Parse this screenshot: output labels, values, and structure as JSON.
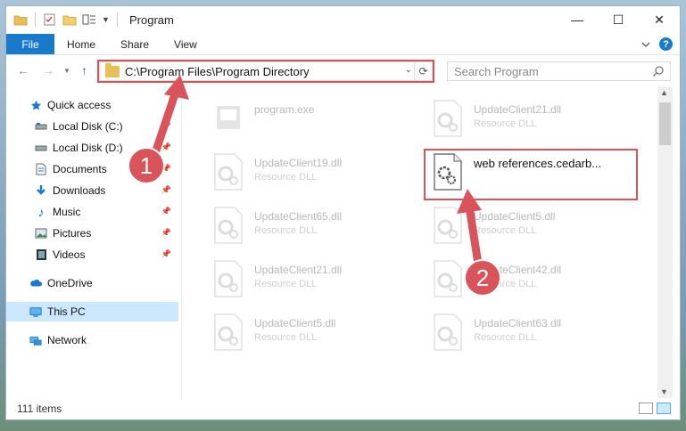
{
  "window": {
    "title": "Program",
    "controls": {
      "minimize": "—",
      "maximize": "☐",
      "close": "✕"
    }
  },
  "ribbon": {
    "tabs": [
      {
        "label": "File"
      },
      {
        "label": "Home"
      },
      {
        "label": "Share"
      },
      {
        "label": "View"
      }
    ],
    "expand_icon": "chevron-down-icon",
    "help_label": "?"
  },
  "nav": {
    "address": "C:\\Program Files\\Program Directory",
    "search_placeholder": "Search Program"
  },
  "sidebar": {
    "items": [
      {
        "label": "Quick access",
        "icon": "star-icon"
      },
      {
        "label": "Local Disk (C:)",
        "icon": "drive-icon",
        "pinned": true
      },
      {
        "label": "Local Disk (D:)",
        "icon": "drive-icon",
        "pinned": true
      },
      {
        "label": "Documents",
        "icon": "documents-icon",
        "pinned": true
      },
      {
        "label": "Downloads",
        "icon": "download-icon",
        "pinned": true
      },
      {
        "label": "Music",
        "icon": "music-icon",
        "pinned": true
      },
      {
        "label": "Pictures",
        "icon": "pictures-icon",
        "pinned": true
      },
      {
        "label": "Videos",
        "icon": "videos-icon",
        "pinned": true
      },
      {
        "label": "OneDrive",
        "icon": "cloud-icon"
      },
      {
        "label": "This PC",
        "icon": "computer-icon",
        "selected": true
      },
      {
        "label": "Network",
        "icon": "network-icon"
      }
    ]
  },
  "files": {
    "left": [
      {
        "name": "program.exe",
        "type": ""
      },
      {
        "name": "UpdateClient19.dll",
        "type": "Resource DLL"
      },
      {
        "name": "UpdateClient65.dll",
        "type": "Resource DLL"
      },
      {
        "name": "UpdateClient21.dll",
        "type": "Resource DLL"
      },
      {
        "name": "UpdateClient5.dll",
        "type": "Resource DLL"
      }
    ],
    "right": [
      {
        "name": "UpdateClient21.dll",
        "type": "Resource DLL"
      },
      {
        "name": "web references.cedarb...",
        "type": "",
        "highlighted": true
      },
      {
        "name": "UpdateClient5.dll",
        "type": "Resource DLL"
      },
      {
        "name": "UpdateClient42.dll",
        "type": "Resource DLL"
      },
      {
        "name": "UpdateClient63.dll",
        "type": "Resource DLL"
      }
    ]
  },
  "status": {
    "item_count": "111 items"
  },
  "annotations": [
    {
      "label": "1",
      "color": "#d9535b"
    },
    {
      "label": "2",
      "color": "#d9535b"
    }
  ]
}
